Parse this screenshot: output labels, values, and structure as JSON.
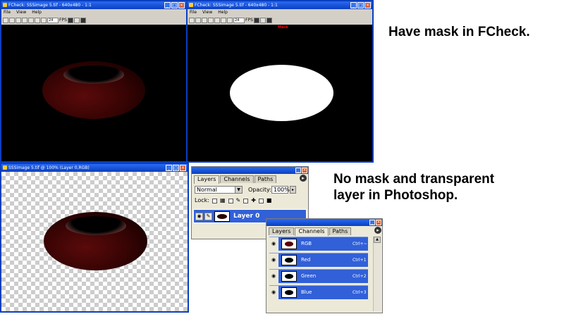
{
  "fcheck_left": {
    "title": "FCheck: SSSimage 5.tif - 640x480 - 1:1",
    "menu": [
      "File",
      "View",
      "Help"
    ],
    "fps_value": "24",
    "fps_label": "FPS"
  },
  "fcheck_right": {
    "title": "FCheck: SSSimage 5.tif - 640x480 - 1:1",
    "menu": [
      "File",
      "View",
      "Help"
    ],
    "fps_value": "24",
    "fps_label": "FPS",
    "mask_label": "Mask"
  },
  "photoshop_doc": {
    "title": "SSSimage 5.tif @ 100% (Layer 0,RGB)"
  },
  "layers_panel": {
    "tabs": [
      "Layers",
      "Channels",
      "Paths"
    ],
    "blend_mode": "Normal",
    "opacity_label": "Opacity:",
    "opacity_value": "100%",
    "lock_label": "Lock:",
    "layer_name": "Layer 0"
  },
  "channels_panel": {
    "tabs": [
      "Layers",
      "Channels",
      "Paths"
    ],
    "channels": [
      {
        "name": "RGB",
        "shortcut": "Ctrl+~"
      },
      {
        "name": "Red",
        "shortcut": "Ctrl+1"
      },
      {
        "name": "Green",
        "shortcut": "Ctrl+2"
      },
      {
        "name": "Blue",
        "shortcut": "Ctrl+3"
      }
    ]
  },
  "captions": {
    "fcheck": "Have mask in FCheck.",
    "photoshop_line1": "No mask and transparent",
    "photoshop_line2": "layer in Photoshop."
  },
  "colors": {
    "title_bar_blue": "#0a3fc0",
    "selection_blue": "#3160d8",
    "mask_label_red": "#ff0000"
  },
  "icons": {
    "eye": "eye-icon",
    "brush": "brush-icon",
    "lock": "lock-icon",
    "move": "move-icon",
    "menu_arrow": "palette-menu-arrow-icon"
  }
}
